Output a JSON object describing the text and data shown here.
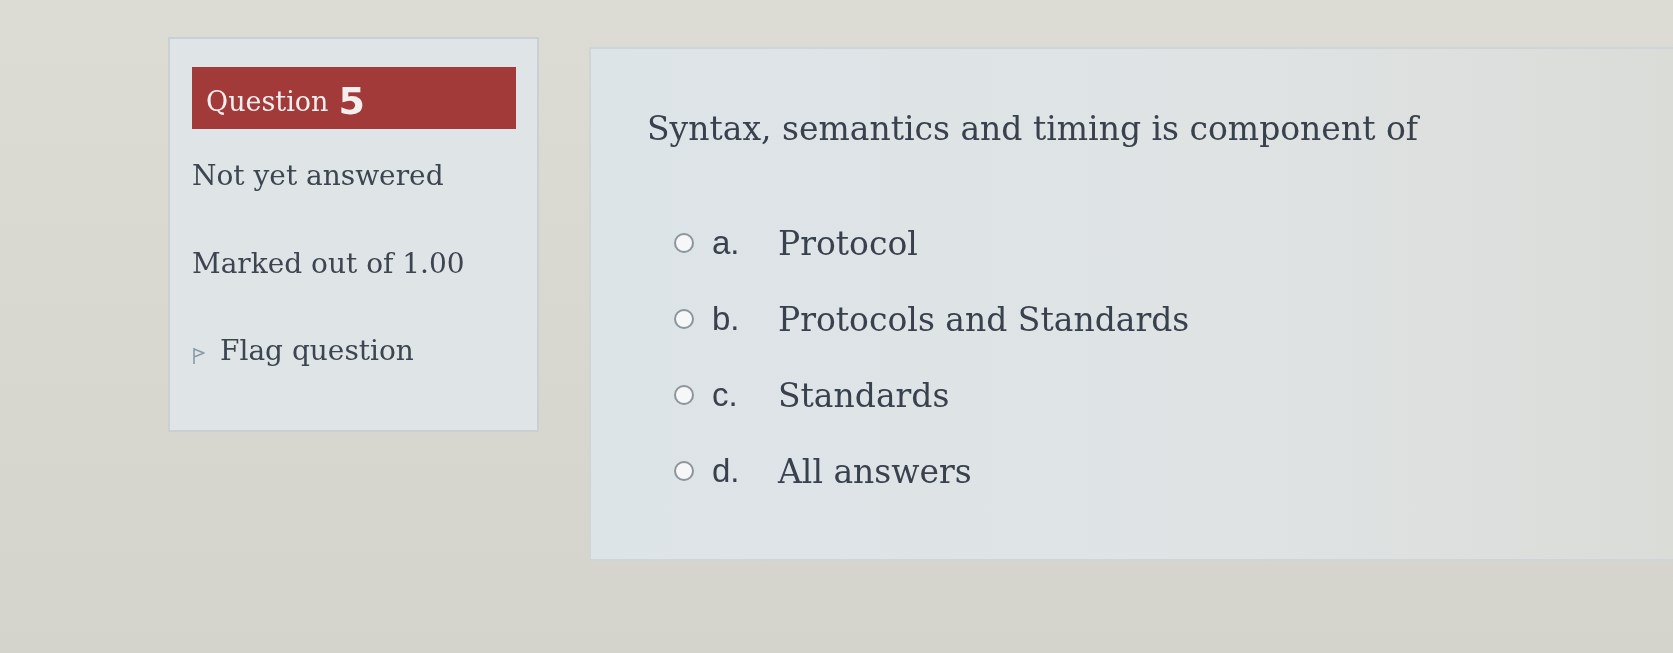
{
  "info": {
    "heading": "Question",
    "number": "5",
    "status": "Not yet answered",
    "marks": "Marked out of 1.00",
    "flag": {
      "label": "Flag question",
      "flagged": false
    }
  },
  "prompt": "Syntax, semantics and timing is component of",
  "options": [
    {
      "letter": "a.",
      "text": "Protocol",
      "selected": false
    },
    {
      "letter": "b.",
      "text": "Protocols and Standards",
      "selected": false
    },
    {
      "letter": "c.",
      "text": "Standards",
      "selected": false
    },
    {
      "letter": "d.",
      "text": "All answers",
      "selected": false
    }
  ]
}
